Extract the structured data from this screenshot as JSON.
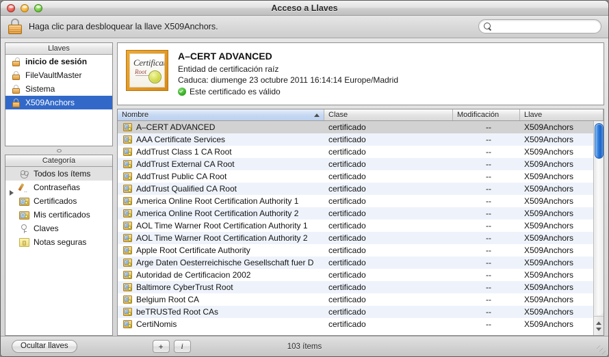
{
  "window": {
    "title": "Acceso a Llaves",
    "traffic_lights": [
      "close-button",
      "minimize-button",
      "zoom-button"
    ]
  },
  "lockbar": {
    "lock_icon": "padlock-locked-icon",
    "message": "Haga clic para desbloquear la llave X509Anchors.",
    "search": {
      "value": "",
      "placeholder": "",
      "icon": "search-icon"
    }
  },
  "sidebar": {
    "keychains": {
      "header": "Llaves",
      "items": [
        {
          "label": "inicio de sesión",
          "icon": "padlock-unlocked-icon",
          "bold": true,
          "selected": false
        },
        {
          "label": "FileVaultMaster",
          "icon": "padlock-locked-icon",
          "bold": false,
          "selected": false
        },
        {
          "label": "Sistema",
          "icon": "padlock-locked-icon",
          "bold": false,
          "selected": false
        },
        {
          "label": "X509Anchors",
          "icon": "padlock-locked-icon",
          "bold": false,
          "selected": true
        }
      ]
    },
    "categories": {
      "header": "Categoría",
      "items": [
        {
          "label": "Todos los ítems",
          "icon": "all-items-icon",
          "selected": true,
          "disclosure": false
        },
        {
          "label": "Contraseñas",
          "icon": "pencil-icon",
          "selected": false,
          "disclosure": true
        },
        {
          "label": "Certificados",
          "icon": "certificate-icon",
          "selected": false,
          "disclosure": false
        },
        {
          "label": "Mis certificados",
          "icon": "certificate-icon",
          "selected": false,
          "disclosure": false
        },
        {
          "label": "Claves",
          "icon": "key-icon",
          "selected": false,
          "disclosure": false
        },
        {
          "label": "Notas seguras",
          "icon": "secure-note-icon",
          "selected": false,
          "disclosure": false
        }
      ]
    }
  },
  "info": {
    "thumbnail": {
      "icon": "certificate-thumbnail-icon",
      "line1": "Certificate",
      "line2": "Root",
      "seal": "gold-seal"
    },
    "name": "A–CERT ADVANCED",
    "kind": "Entidad de certificación raíz",
    "expiry": "Caduca: diumenge 23 octubre 2011 16:14:14 Europe/Madrid",
    "validity": "Este certificado es válido",
    "validity_icon": "green-check-icon"
  },
  "table": {
    "columns": [
      {
        "key": "name",
        "label": "Nombre",
        "sorted": true,
        "sort_direction": "asc"
      },
      {
        "key": "class",
        "label": "Clase",
        "sorted": false,
        "sort_direction": ""
      },
      {
        "key": "mod",
        "label": "Modificación",
        "sorted": false,
        "sort_direction": ""
      },
      {
        "key": "key",
        "label": "Llave",
        "sorted": false,
        "sort_direction": ""
      }
    ],
    "rows": [
      {
        "name": "A–CERT ADVANCED",
        "class": "certificado",
        "mod": "--",
        "key": "X509Anchors",
        "selected": true
      },
      {
        "name": "AAA Certificate Services",
        "class": "certificado",
        "mod": "--",
        "key": "X509Anchors",
        "selected": false
      },
      {
        "name": "AddTrust Class 1 CA Root",
        "class": "certificado",
        "mod": "--",
        "key": "X509Anchors",
        "selected": false
      },
      {
        "name": "AddTrust External CA Root",
        "class": "certificado",
        "mod": "--",
        "key": "X509Anchors",
        "selected": false
      },
      {
        "name": "AddTrust Public CA Root",
        "class": "certificado",
        "mod": "--",
        "key": "X509Anchors",
        "selected": false
      },
      {
        "name": "AddTrust Qualified CA Root",
        "class": "certificado",
        "mod": "--",
        "key": "X509Anchors",
        "selected": false
      },
      {
        "name": "America Online Root Certification Authority 1",
        "class": "certificado",
        "mod": "--",
        "key": "X509Anchors",
        "selected": false
      },
      {
        "name": "America Online Root Certification Authority 2",
        "class": "certificado",
        "mod": "--",
        "key": "X509Anchors",
        "selected": false
      },
      {
        "name": "AOL Time Warner Root Certification Authority 1",
        "class": "certificado",
        "mod": "--",
        "key": "X509Anchors",
        "selected": false
      },
      {
        "name": "AOL Time Warner Root Certification Authority 2",
        "class": "certificado",
        "mod": "--",
        "key": "X509Anchors",
        "selected": false
      },
      {
        "name": "Apple Root Certificate Authority",
        "class": "certificado",
        "mod": "--",
        "key": "X509Anchors",
        "selected": false
      },
      {
        "name": "Arge Daten Oesterreichische Gesellschaft fuer D",
        "class": "certificado",
        "mod": "--",
        "key": "X509Anchors",
        "selected": false
      },
      {
        "name": "Autoridad de Certificacion 2002",
        "class": "certificado",
        "mod": "--",
        "key": "X509Anchors",
        "selected": false
      },
      {
        "name": "Baltimore CyberTrust Root",
        "class": "certificado",
        "mod": "--",
        "key": "X509Anchors",
        "selected": false
      },
      {
        "name": "Belgium Root CA",
        "class": "certificado",
        "mod": "--",
        "key": "X509Anchors",
        "selected": false
      },
      {
        "name": "beTRUSTed Root CAs",
        "class": "certificado",
        "mod": "--",
        "key": "X509Anchors",
        "selected": false
      },
      {
        "name": "CertiNomis",
        "class": "certificado",
        "mod": "--",
        "key": "X509Anchors",
        "selected": false
      }
    ],
    "scrollbar": {
      "icon_up": "scroll-up-arrow-icon",
      "icon_down": "scroll-down-arrow-icon"
    }
  },
  "bottombar": {
    "hide_keychains_label": "Ocultar llaves",
    "add_label": "+",
    "info_label": "i",
    "item_count": "103 ítems",
    "resize_grip": "resize-grip-icon"
  },
  "colors": {
    "selection_blue": "#3269c9",
    "row_stripe": "#eef3fb",
    "valid_green": "#31a81f",
    "cert_gold": "#e0b048",
    "scrollbar_blue": "#2f7fe0"
  }
}
